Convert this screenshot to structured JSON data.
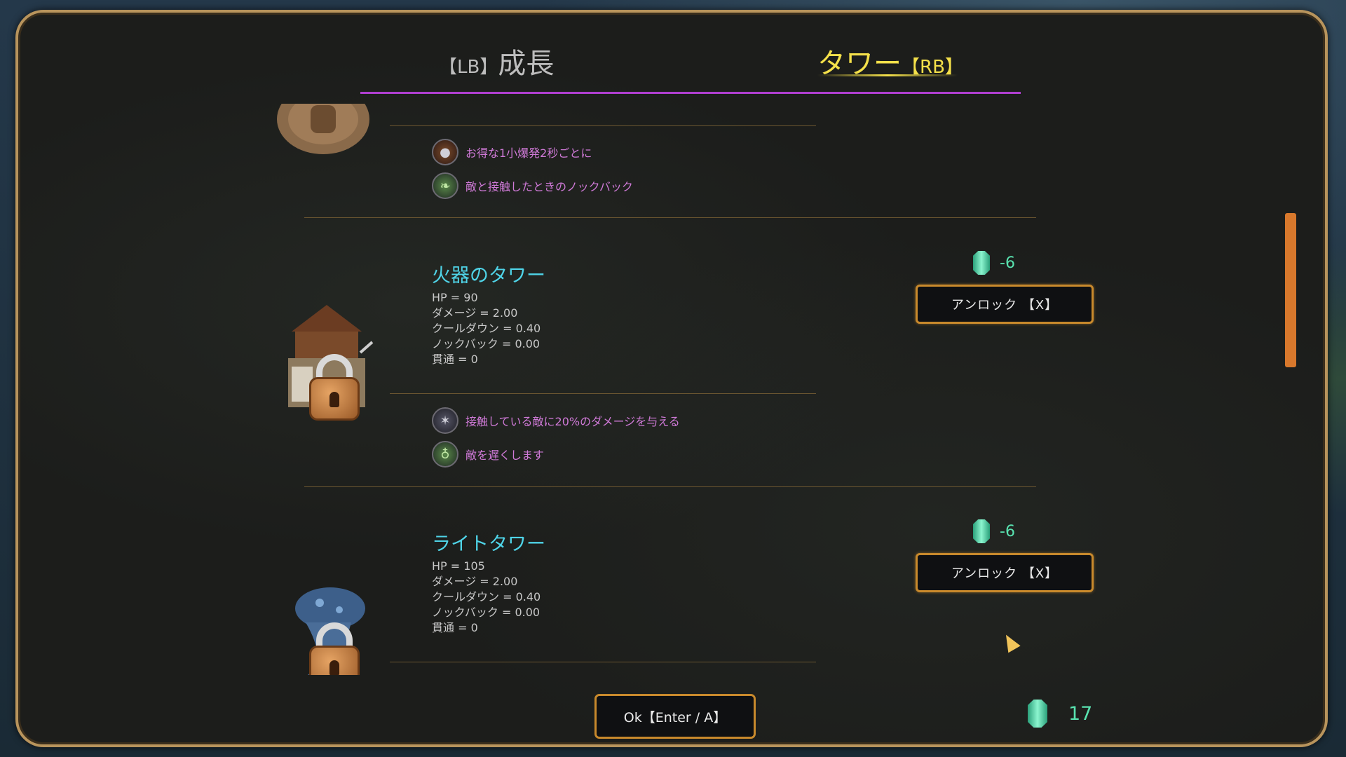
{
  "tabs": [
    {
      "key": "【LB】",
      "label": "成長",
      "active": false
    },
    {
      "key": "【RB】",
      "label": "タワー",
      "active": true
    }
  ],
  "top_partial": {
    "perks": [
      {
        "icon": "bomb-icon",
        "text": "お得な1小爆発2秒ごとに"
      },
      {
        "icon": "leaf-knockback-icon",
        "text": "敵と接触したときのノックバック"
      }
    ]
  },
  "towers": [
    {
      "name": "火器のタワー",
      "stats": [
        "HP = 90",
        "ダメージ = 2.00",
        "クールダウン = 0.40",
        "ノックバック = 0.00",
        "貫通 = 0"
      ],
      "cost": "-6",
      "unlock_label": "アンロック 【X】",
      "locked": true,
      "perks": [
        {
          "icon": "claw-icon",
          "text": "接触している敵に20%のダメージを与える"
        },
        {
          "icon": "slow-icon",
          "text": "敵を遅くします"
        }
      ]
    },
    {
      "name": "ライトタワー",
      "stats": [
        "HP = 105",
        "ダメージ = 2.00",
        "クールダウン = 0.40",
        "ノックバック = 0.00",
        "貫通 = 0"
      ],
      "cost": "-6",
      "unlock_label": "アンロック 【X】",
      "locked": true,
      "perks": []
    }
  ],
  "footer": {
    "ok_label": "Ok【Enter / A】",
    "gem_total": "17"
  },
  "colors": {
    "accent_gold": "#c8892c",
    "tab_active": "#f4e04a",
    "gem": "#59e3b0",
    "tower_title": "#4fd4e8",
    "perk_text": "#d07ad8",
    "scrollbar": "#d8782c"
  }
}
